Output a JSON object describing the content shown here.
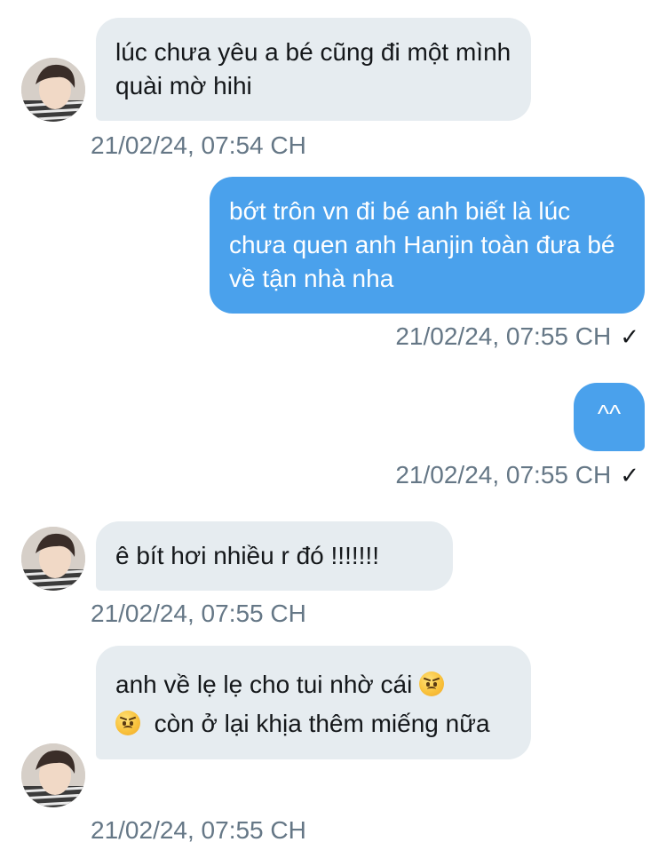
{
  "messages": [
    {
      "direction": "in",
      "text": "lúc chưa yêu a bé cũng đi một mình quài mờ hihi",
      "time": "21/02/24, 07:54 CH"
    },
    {
      "direction": "out",
      "text": "bớt trôn vn đi bé anh biết là lúc chưa quen anh Hanjin toàn đưa bé về tận nhà nha",
      "time": "21/02/24, 07:55 CH",
      "read_mark": "✓"
    },
    {
      "direction": "out",
      "text": "^^",
      "time": "21/02/24, 07:55 CH",
      "read_mark": "✓"
    },
    {
      "direction": "in",
      "text": "ê bít hơi nhiều r đó !!!!!!!",
      "time": "21/02/24, 07:55 CH"
    },
    {
      "direction": "in",
      "text_part1": "anh về lẹ lẹ cho tui nhờ cái",
      "text_part2": "còn ở lại khịa thêm miếng nữa",
      "emoji_icon": "angry-face-icon",
      "time": "21/02/24, 07:55 CH"
    }
  ],
  "colors": {
    "incoming_bubble": "#e6ecf0",
    "outgoing_bubble": "#4aa1ec",
    "timestamp": "#657786"
  }
}
